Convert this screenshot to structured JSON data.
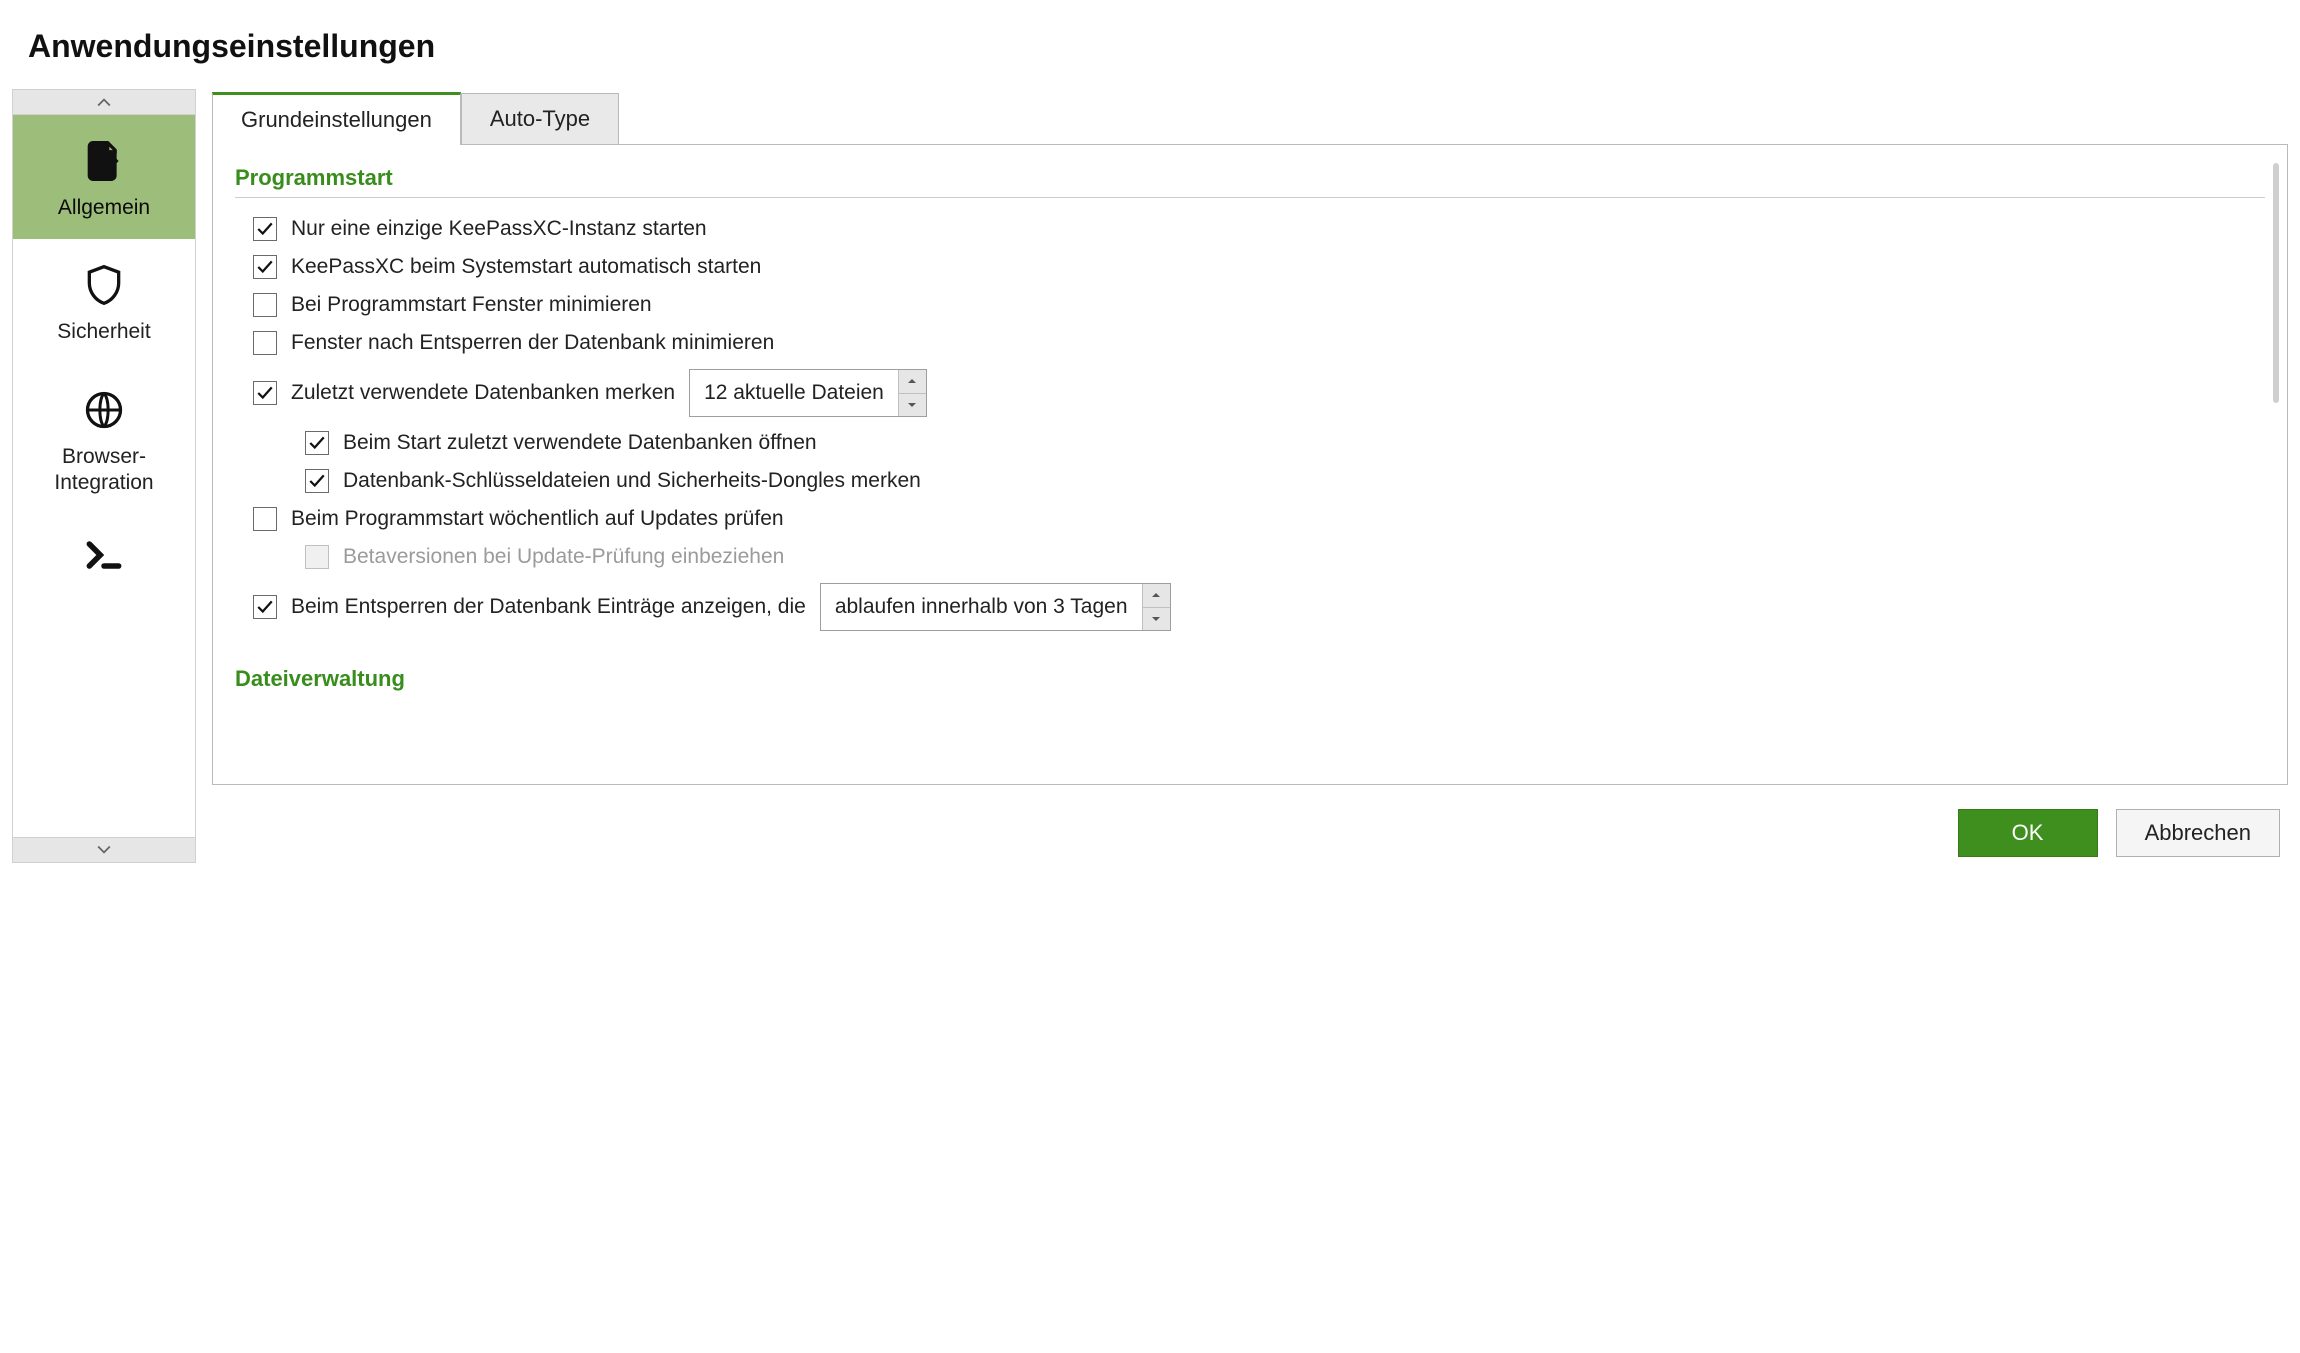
{
  "title": "Anwendungseinstellungen",
  "sidebar": {
    "items": [
      {
        "label": "Allgemein"
      },
      {
        "label": "Sicherheit"
      },
      {
        "label": "Browser-Integration"
      }
    ]
  },
  "tabs": [
    {
      "label": "Grundeinstellungen"
    },
    {
      "label": "Auto-Type"
    }
  ],
  "sections": {
    "start": {
      "title": "Programmstart",
      "opt_single_instance": "Nur eine einzige KeePassXC-Instanz starten",
      "opt_autostart": "KeePassXC beim Systemstart automatisch starten",
      "opt_minimize_on_start": "Bei Programmstart Fenster minimieren",
      "opt_minimize_after_unlock": "Fenster nach Entsperren der Datenbank minimieren",
      "opt_remember_recent": "Zuletzt verwendete Datenbanken merken",
      "recent_value": "12 aktuelle Dateien",
      "opt_open_recent": "Beim Start zuletzt verwendete Datenbanken öffnen",
      "opt_remember_keyfiles": "Datenbank-Schlüsseldateien und Sicherheits-Dongles merken",
      "opt_check_updates": "Beim Programmstart wöchentlich auf Updates prüfen",
      "opt_beta_updates": "Betaversionen bei Update-Prüfung einbeziehen",
      "opt_show_expired": "Beim Entsperren der Datenbank Einträge anzeigen, die",
      "expire_value": "ablaufen innerhalb von 3 Tagen"
    },
    "files": {
      "title": "Dateiverwaltung"
    }
  },
  "buttons": {
    "ok": "OK",
    "cancel": "Abbrechen"
  }
}
